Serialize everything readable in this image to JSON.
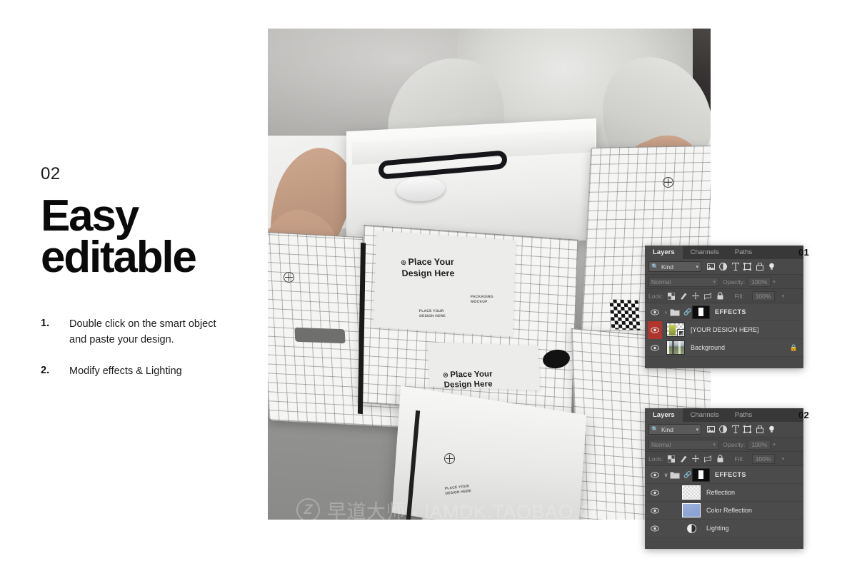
{
  "left": {
    "step_number": "02",
    "headline_line1": "Easy",
    "headline_line2": "editable",
    "bullets": [
      {
        "num": "1.",
        "text": "Double click on the smart object and paste your design."
      },
      {
        "num": "2.",
        "text": "Modify effects & Lighting"
      }
    ]
  },
  "photo": {
    "design_placeholder_main": "Place Your\nDesign Here",
    "design_placeholder_sub": "Place Your\nDesign Here",
    "micro_1": "PLACE YOUR\nDESIGN HERE",
    "micro_2": "PACKAGING\nMOCKUP",
    "micro_3": "PLACE YOUR\nDESIGN HERE",
    "registration_mark": "registration-mark",
    "watermark_logo": "Z",
    "watermark_text": "早道大师 - IAMDK.TAOBAO.COM"
  },
  "panels": [
    {
      "badge": "01",
      "tabs": [
        {
          "label": "Layers",
          "active": true
        },
        {
          "label": "Channels",
          "active": false
        },
        {
          "label": "Paths",
          "active": false
        }
      ],
      "filter": {
        "kind_label": "Kind",
        "search_icon": "search-icon",
        "icons": [
          "pixel-layer-filter-icon",
          "adjustment-layer-filter-icon",
          "type-layer-filter-icon",
          "shape-layer-filter-icon",
          "smart-object-filter-icon",
          "filter-toggle-icon"
        ]
      },
      "blend": {
        "mode": "Normal",
        "opacity_label": "Opacity:",
        "opacity_value": "100%"
      },
      "lock": {
        "label": "Lock:",
        "fill_label": "Fill:",
        "fill_value": "100%",
        "icons": [
          "lock-transparency-icon",
          "lock-image-icon",
          "lock-position-icon",
          "lock-artboard-icon",
          "lock-all-icon"
        ]
      },
      "rows": [
        {
          "name": "EFFECTS",
          "type": "group",
          "bold": true,
          "disclosure": "›",
          "expanded": false,
          "visible": true,
          "selected": false,
          "mask": true,
          "linked": true,
          "locked": false
        },
        {
          "name": "[YOUR DESIGN HERE]",
          "type": "smart-object",
          "bold": false,
          "visible": true,
          "selected": false,
          "eye_highlight": true,
          "locked": false
        },
        {
          "name": "Background",
          "type": "image",
          "bold": false,
          "visible": true,
          "selected": false,
          "locked": true
        }
      ]
    },
    {
      "badge": "02",
      "tabs": [
        {
          "label": "Layers",
          "active": true
        },
        {
          "label": "Channels",
          "active": false
        },
        {
          "label": "Paths",
          "active": false
        }
      ],
      "filter": {
        "kind_label": "Kind",
        "search_icon": "search-icon",
        "icons": [
          "pixel-layer-filter-icon",
          "adjustment-layer-filter-icon",
          "type-layer-filter-icon",
          "shape-layer-filter-icon",
          "smart-object-filter-icon",
          "filter-toggle-icon"
        ]
      },
      "blend": {
        "mode": "Normal",
        "opacity_label": "Opacity:",
        "opacity_value": "100%"
      },
      "lock": {
        "label": "Lock:",
        "fill_label": "Fill:",
        "fill_value": "100%",
        "icons": [
          "lock-transparency-icon",
          "lock-image-icon",
          "lock-position-icon",
          "lock-artboard-icon",
          "lock-all-icon"
        ]
      },
      "rows": [
        {
          "name": "EFFECTS",
          "type": "group",
          "bold": true,
          "disclosure": "∨",
          "expanded": true,
          "visible": true,
          "selected": false,
          "mask": true,
          "linked": true,
          "locked": false
        },
        {
          "name": "Reflection",
          "type": "pixel-transparent",
          "bold": false,
          "visible": true,
          "child": true,
          "locked": false
        },
        {
          "name": "Color Reflection",
          "type": "pixel-blue",
          "bold": false,
          "visible": true,
          "child": true,
          "locked": false
        },
        {
          "name": "Lighting",
          "type": "adjustment",
          "bold": false,
          "visible": true,
          "child": true,
          "locked": false
        }
      ]
    }
  ],
  "colors": {
    "page_background": "#ffffff",
    "text": "#111111",
    "panel_background": "#494949",
    "panel_tabbar": "#383838",
    "panel_tab_active": "#4a4a4a",
    "panel_row": "#4b4b4b",
    "eye_highlight_red": "#b0352d",
    "color_reflection_swatch": "#8ea6d6"
  }
}
